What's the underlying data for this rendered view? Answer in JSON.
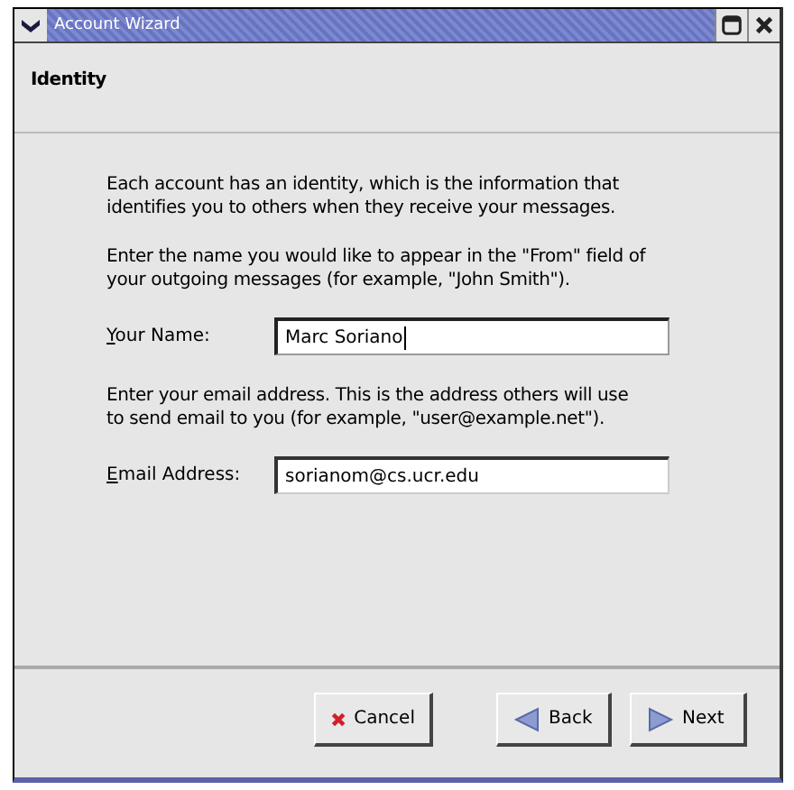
{
  "window": {
    "title": "Account Wizard"
  },
  "page_title": "Identity",
  "paragraphs": [
    "Each account has an identity, which is the information that identifies you to others when they receive your messages.",
    "Enter the name you would like to appear in the \"From\" field of your outgoing messages (for example, \"John Smith\").",
    "Enter your email address. This is the address others will use to send email to you (for example, \"user@example.net\")."
  ],
  "fields": [
    {
      "label": "Your Name:",
      "value": "Marc Soriano",
      "focused": true
    },
    {
      "label": "Email Address:",
      "value": "sorianom@cs.ucr.edu",
      "focused": false
    }
  ],
  "buttons": [
    {
      "label": "Cancel",
      "kind": "cancel"
    },
    {
      "label": "Back",
      "kind": "back"
    },
    {
      "label": "Next",
      "kind": "next"
    }
  ]
}
